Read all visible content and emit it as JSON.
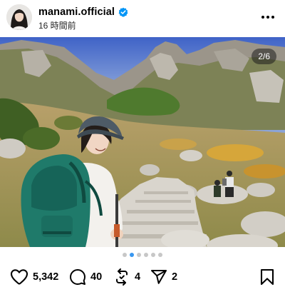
{
  "post": {
    "username": "manami.official",
    "time_ago": "16 時間前",
    "verified": true,
    "slide_counter": "2/6",
    "carousel": {
      "total": 6,
      "current": 2
    },
    "likes": "5,342",
    "comments": "40",
    "reposts": "4",
    "shares": "2"
  },
  "icons": {
    "avatar": "avatar",
    "verified": "verified-badge-icon",
    "more": "more-horizontal-icon",
    "like": "heart-icon",
    "comment": "comment-bubble-icon",
    "repost": "repost-icon",
    "share": "paper-plane-icon",
    "save": "bookmark-icon"
  },
  "colors": {
    "verified_badge": "#0095f6",
    "active_dot": "#3897f0",
    "inactive_dot": "#c7c7c7",
    "text": "#000000"
  }
}
